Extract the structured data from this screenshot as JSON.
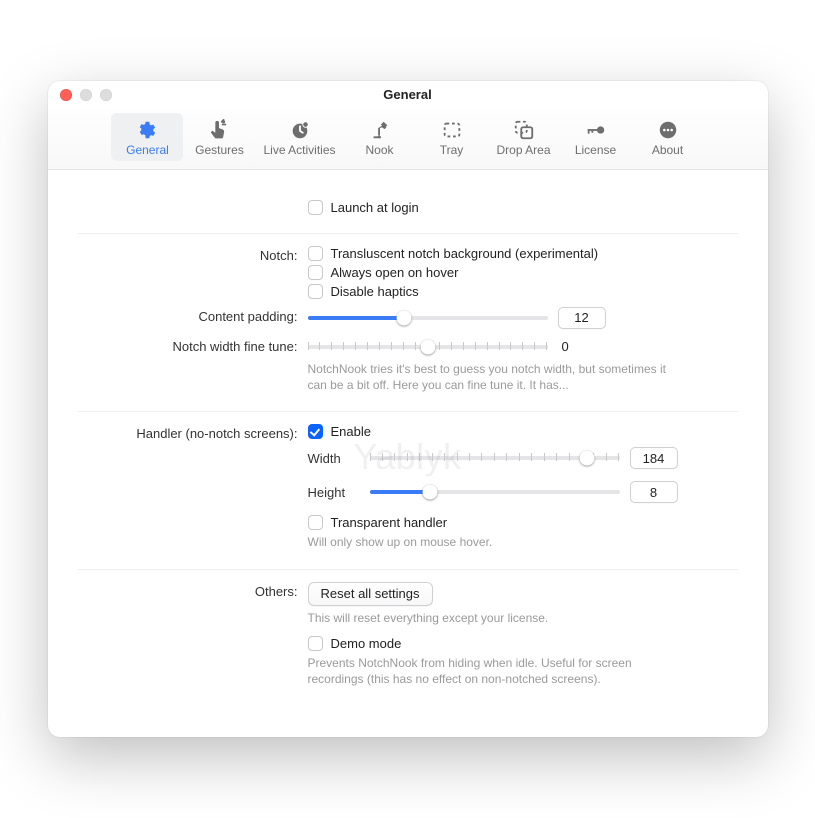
{
  "window": {
    "title": "General"
  },
  "tabs": [
    {
      "id": "general",
      "label": "General",
      "icon": "gear-icon",
      "active": true
    },
    {
      "id": "gestures",
      "label": "Gestures",
      "icon": "tap-icon",
      "active": false
    },
    {
      "id": "live-activities",
      "label": "Live Activities",
      "icon": "clock-icon",
      "active": false
    },
    {
      "id": "nook",
      "label": "Nook",
      "icon": "lamp-icon",
      "active": false
    },
    {
      "id": "tray",
      "label": "Tray",
      "icon": "tray-icon",
      "active": false
    },
    {
      "id": "drop-area",
      "label": "Drop Area",
      "icon": "drop-icon",
      "active": false
    },
    {
      "id": "license",
      "label": "License",
      "icon": "key-icon",
      "active": false
    },
    {
      "id": "about",
      "label": "About",
      "icon": "ellipsis-icon",
      "active": false
    }
  ],
  "top": {
    "launch_at_login": "Launch at login"
  },
  "notch": {
    "heading": "Notch:",
    "transluscent": "Transluscent notch background (experimental)",
    "always_hover": "Always open on hover",
    "disable_haptics": "Disable haptics",
    "content_padding_label": "Content padding:",
    "content_padding_value": "12",
    "width_finetune_label": "Notch width fine tune:",
    "width_finetune_value": "0",
    "width_finetune_hint": "NotchNook tries it's best to guess you notch width, but sometimes it can be a bit off. Here you can fine tune it. It has..."
  },
  "handler": {
    "heading": "Handler (no-notch screens):",
    "enable": "Enable",
    "width_label": "Width",
    "width_value": "184",
    "height_label": "Height",
    "height_value": "8",
    "transparent": "Transparent handler",
    "transparent_hint": "Will only show up on mouse hover."
  },
  "others": {
    "heading": "Others:",
    "reset_button": "Reset all settings",
    "reset_hint": "This will reset everything except your license.",
    "demo_label": "Demo mode",
    "demo_hint": "Prevents NotchNook from hiding when idle. Useful for screen recordings (this has no effect on non-notched screens)."
  },
  "watermark": "Yablyk",
  "slider": {
    "content_padding_pct": 40,
    "width_finetune_pct": 50,
    "handler_width_pct": 87,
    "handler_height_pct": 24
  }
}
